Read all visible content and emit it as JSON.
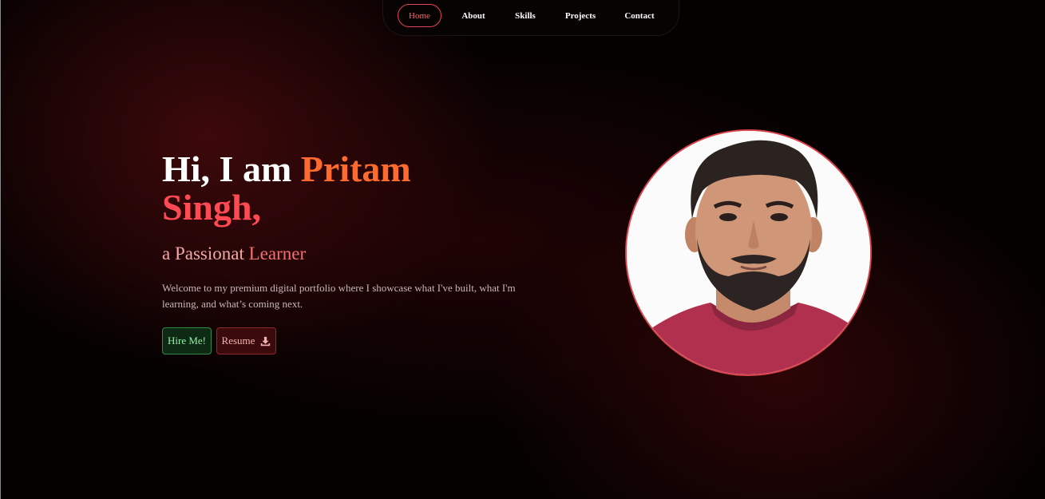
{
  "nav": {
    "items": [
      {
        "label": "Home",
        "active": true
      },
      {
        "label": "About",
        "active": false
      },
      {
        "label": "Skills",
        "active": false
      },
      {
        "label": "Projects",
        "active": false
      },
      {
        "label": "Contact",
        "active": false
      }
    ]
  },
  "hero": {
    "greeting": "Hi, I am ",
    "first_name": "Pritam",
    "last_name": "Singh,",
    "subtitle_prefix": "a Passionat ",
    "subtitle_accent": "Learner",
    "description": "Welcome to my premium digital portfolio where I showcase what I've built, what I'm learning, and what’s coming next.",
    "hire_label": "Hire Me!",
    "resume_label": "Resume",
    "resume_icon": "download-icon"
  },
  "avatar": {
    "subject": "profile-photo"
  },
  "colors": {
    "accent_orange": "#ff6a2e",
    "accent_red": "#ff4a53",
    "hire_green": "#8ff2a6",
    "border_red": "#d9434b"
  }
}
